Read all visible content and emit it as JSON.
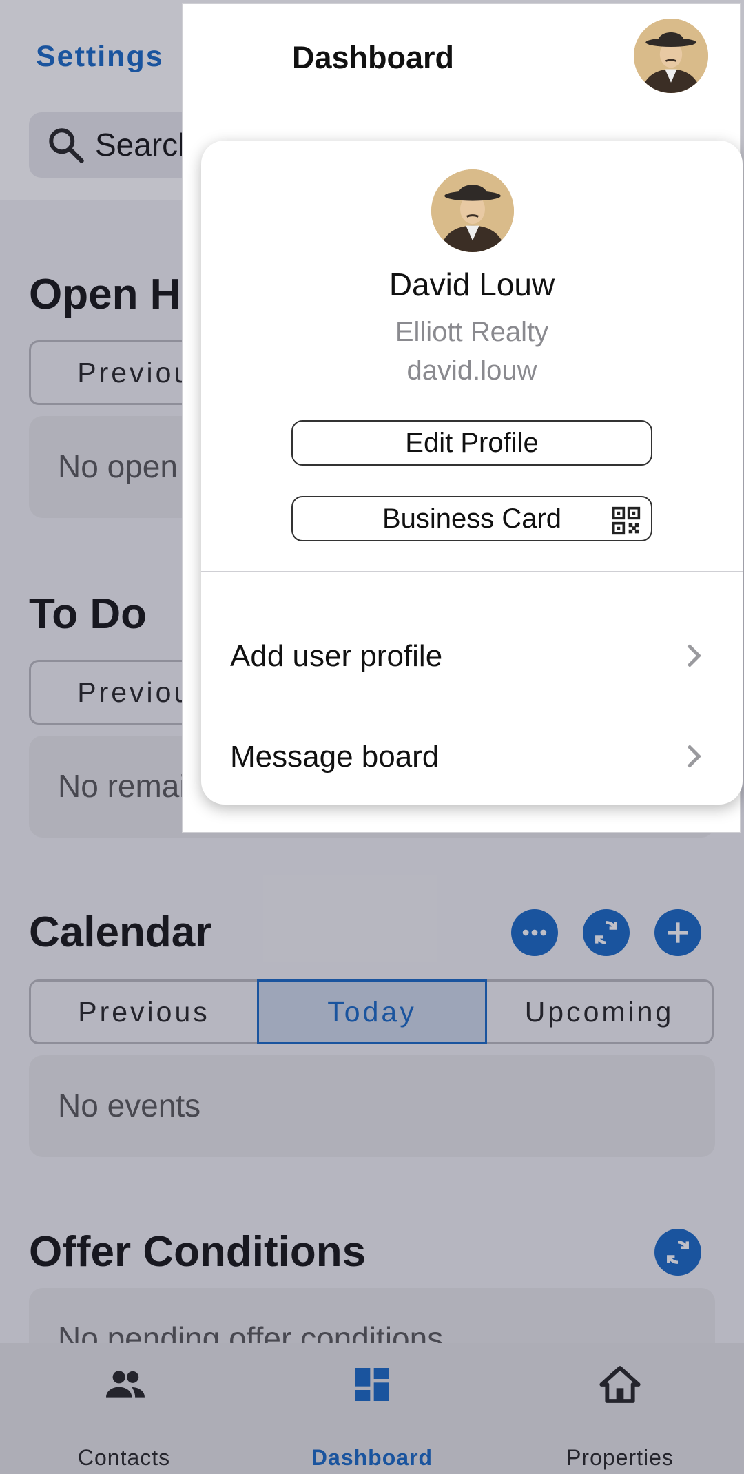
{
  "header": {
    "settings_label": "Settings",
    "search_placeholder": "Search"
  },
  "sections": {
    "open_house": {
      "title": "Open Ho",
      "tab_previous": "Previous",
      "empty_text": "No open h"
    },
    "todo": {
      "title": "To Do",
      "tab_previous": "Previous",
      "empty_text": "No remaining todays"
    },
    "calendar": {
      "title": "Calendar",
      "tabs": [
        "Previous",
        "Today",
        "Upcoming"
      ],
      "selected_tab": "Today",
      "empty_text": "No events"
    },
    "offer_conditions": {
      "title": "Offer Conditions",
      "empty_text": "No pending offer conditions"
    }
  },
  "bottom_nav": {
    "items": [
      {
        "label": "Contacts",
        "icon": "people-icon"
      },
      {
        "label": "Dashboard",
        "icon": "dashboard-icon",
        "active": true
      },
      {
        "label": "Properties",
        "icon": "house-icon"
      }
    ]
  },
  "panel": {
    "title": "Dashboard"
  },
  "profile": {
    "name": "David Louw",
    "company": "Elliott Realty",
    "username": "david.louw",
    "edit_profile_label": "Edit Profile",
    "business_card_label": "Business Card",
    "menu": [
      {
        "label": "Add user profile"
      },
      {
        "label": "Message board"
      }
    ]
  },
  "colors": {
    "accent": "#1466c5",
    "background": "#f3f3f5",
    "card": "#e8e8ea",
    "overlay": "rgba(44,44,70,0.30)"
  }
}
